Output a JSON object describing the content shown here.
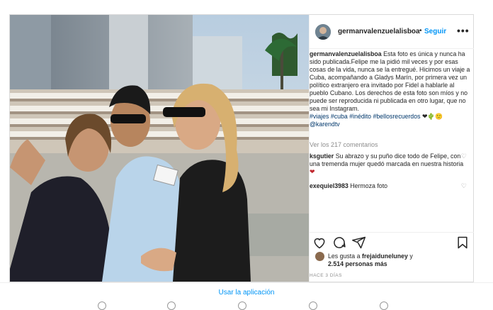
{
  "post": {
    "username": "germanvalenzuelalisboa",
    "dot": "•",
    "follow_label": "Seguir",
    "more_label": "•••",
    "caption_user": "germanvalenzuelalisboa",
    "caption_text": "Esta foto es única y nunca ha sido publicada.Felipe me la pidió mil veces y por esas cosas de la vida, nunca se la entregué. Hicimos un viaje a Cuba, acompañando a Gladys Marín, por primera vez un político extranjero era invitado por Fidel a hablarle al pueblo Cubano. Los derechos de esta foto son míos y no puede ser reproducida ni publicada en otro lugar, que no sea mi Instagram.",
    "hashtags": "#viajes #cuba #inédito #bellosrecuerdos",
    "emojis": "❤🌵🙂",
    "mention": "@karendtv",
    "view_comments": "Ver los 217 comentarios",
    "comments": [
      {
        "user": "ksgutier",
        "text": "Su abrazo y su puño dice todo de Felipe, con una tremenda mujer quedó marcada en nuestra historia",
        "emoji": "❤"
      },
      {
        "user": "exequiel3983",
        "text": "Hermoza foto",
        "emoji": ""
      }
    ],
    "likes_prefix": "Les gusta a",
    "likes_user": "frejaiduneluney",
    "likes_and": "y",
    "likes_count": "2.514 personas más",
    "time": "HACE 3 DÍAS"
  },
  "footer": {
    "use_app": "Usar la aplicación"
  },
  "icons": {
    "like": "heart-icon",
    "comment": "comment-icon",
    "share": "share-icon",
    "save": "bookmark-icon"
  },
  "colors": {
    "link_blue": "#0095f6",
    "hashtag": "#00376b",
    "muted": "#8e8e8e",
    "border": "#dbdbdb"
  }
}
